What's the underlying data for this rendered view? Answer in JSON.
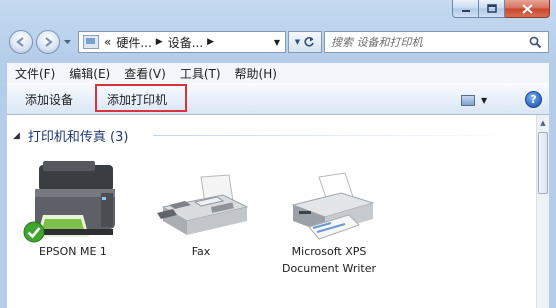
{
  "nav": {
    "breadcrumb_lead": "«",
    "breadcrumb": [
      "硬件...",
      "设备..."
    ],
    "search_placeholder": "搜索 设备和打印机"
  },
  "menu": {
    "items": [
      "文件(F)",
      "编辑(E)",
      "查看(V)",
      "工具(T)",
      "帮助(H)"
    ]
  },
  "toolbar": {
    "add_device": "添加设备",
    "add_printer": "添加打印机",
    "help": "?"
  },
  "group": {
    "title": "打印机和传真 (3)"
  },
  "devices": [
    {
      "label": "EPSON ME 1",
      "icon": "printer-icon",
      "is_default": true
    },
    {
      "label": "Fax",
      "icon": "fax-icon",
      "is_default": false
    },
    {
      "label": "Microsoft XPS Document Writer",
      "icon": "xps-printer-icon",
      "is_default": false
    }
  ],
  "colors": {
    "highlight_border": "#d9343c",
    "group_title": "#1e3a6e",
    "window_frame": "#b5cde9"
  }
}
